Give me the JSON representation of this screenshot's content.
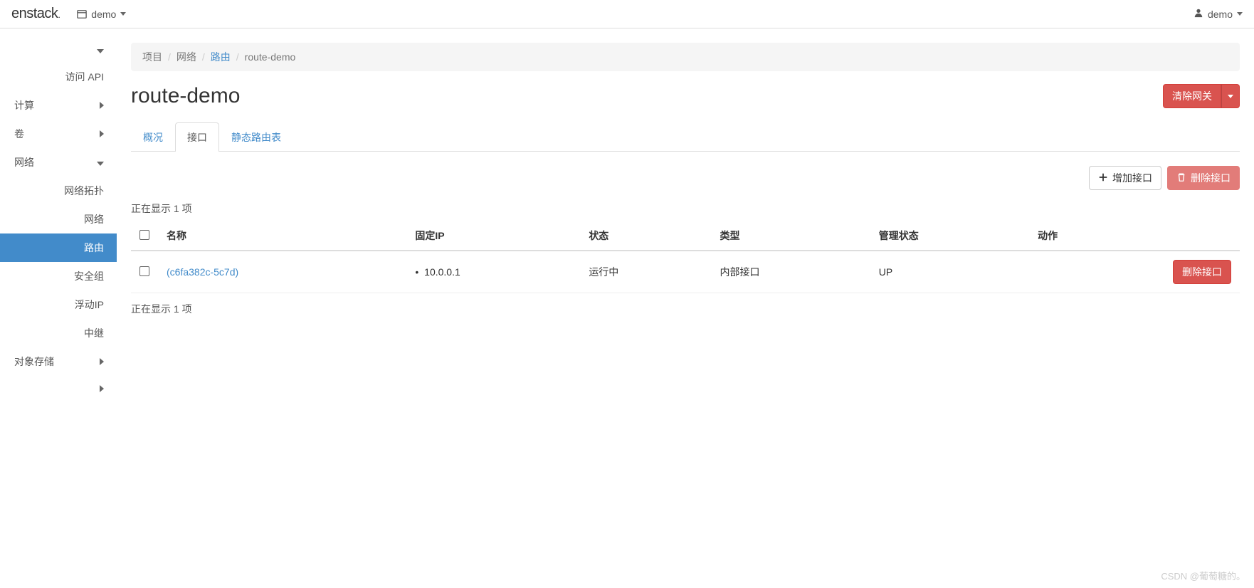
{
  "navbar": {
    "brand": "enstack",
    "project_label": "demo",
    "user_label": "demo"
  },
  "sidebar": {
    "api_label": "访问 API",
    "compute_label": "计算",
    "volume_label": "卷",
    "network_label": "网络",
    "network_sub": {
      "topology": "网络拓扑",
      "networks": "网络",
      "routers": "路由",
      "security_groups": "安全组",
      "floating_ips": "浮动IP",
      "trunks": "中继"
    },
    "object_storage_label": "对象存储"
  },
  "breadcrumb": {
    "items": [
      "项目",
      "网络",
      "路由",
      "route-demo"
    ]
  },
  "page": {
    "title": "route-demo",
    "clear_gateway_btn": "清除网关"
  },
  "tabs": {
    "overview": "概况",
    "interfaces": "接口",
    "static_routes": "静态路由表"
  },
  "actions": {
    "add_interface": "增加接口",
    "delete_interfaces": "删除接口"
  },
  "table": {
    "showing_top": "正在显示 1 项",
    "showing_bottom": "正在显示 1 项",
    "headers": {
      "name": "名称",
      "fixed_ip": "固定IP",
      "status": "状态",
      "type": "类型",
      "admin_state": "管理状态",
      "actions": "动作"
    },
    "rows": [
      {
        "name": "(c6fa382c-5c7d)",
        "fixed_ip": "10.0.0.1",
        "status": "运行中",
        "type": "内部接口",
        "admin_state": "UP",
        "action_label": "删除接口"
      }
    ]
  },
  "watermark": "CSDN @葡萄糖的。"
}
